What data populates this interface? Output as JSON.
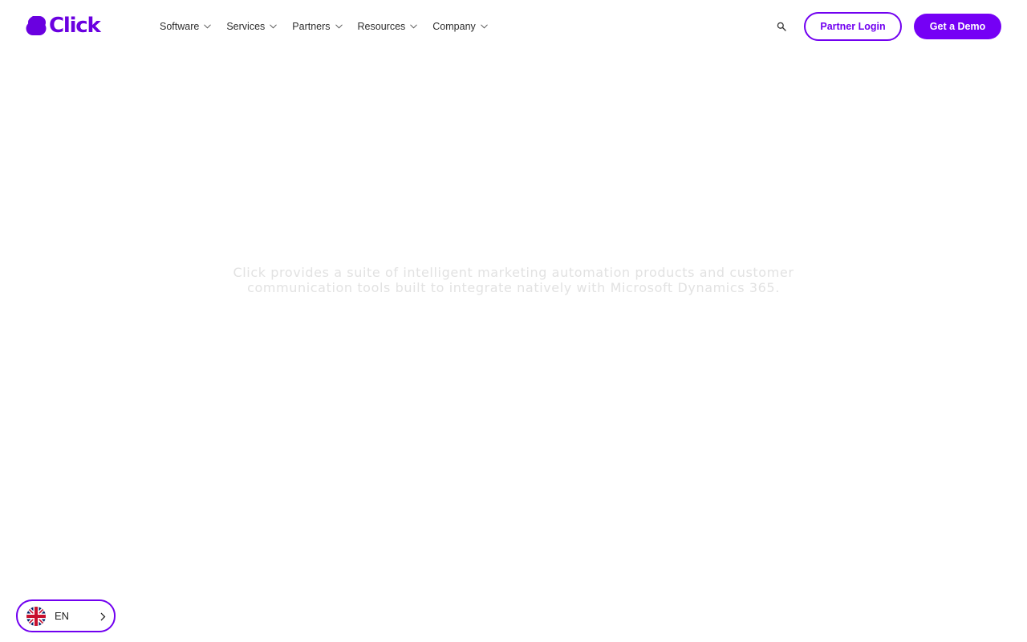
{
  "brand": {
    "name": "Click",
    "color": "#7100f0"
  },
  "nav": {
    "items": [
      {
        "label": "Software",
        "icon": "chevron-down-icon"
      },
      {
        "label": "Services",
        "icon": "chevron-down-icon"
      },
      {
        "label": "Partners",
        "icon": "chevron-down-icon"
      },
      {
        "label": "Resources",
        "icon": "chevron-down-icon"
      },
      {
        "label": "Company",
        "icon": "chevron-down-icon"
      }
    ],
    "search_icon": "search-icon",
    "partner_login_label": "Partner Login",
    "demo_label": "Get a Demo"
  },
  "hero": {
    "tagline": "Click provides a suite of intelligent marketing automation products and customer communication tools built to integrate natively with Microsoft Dynamics 365."
  },
  "language": {
    "code": "EN",
    "flag_icon": "uk-flag-icon",
    "chevron_icon": "chevron-right-icon"
  }
}
